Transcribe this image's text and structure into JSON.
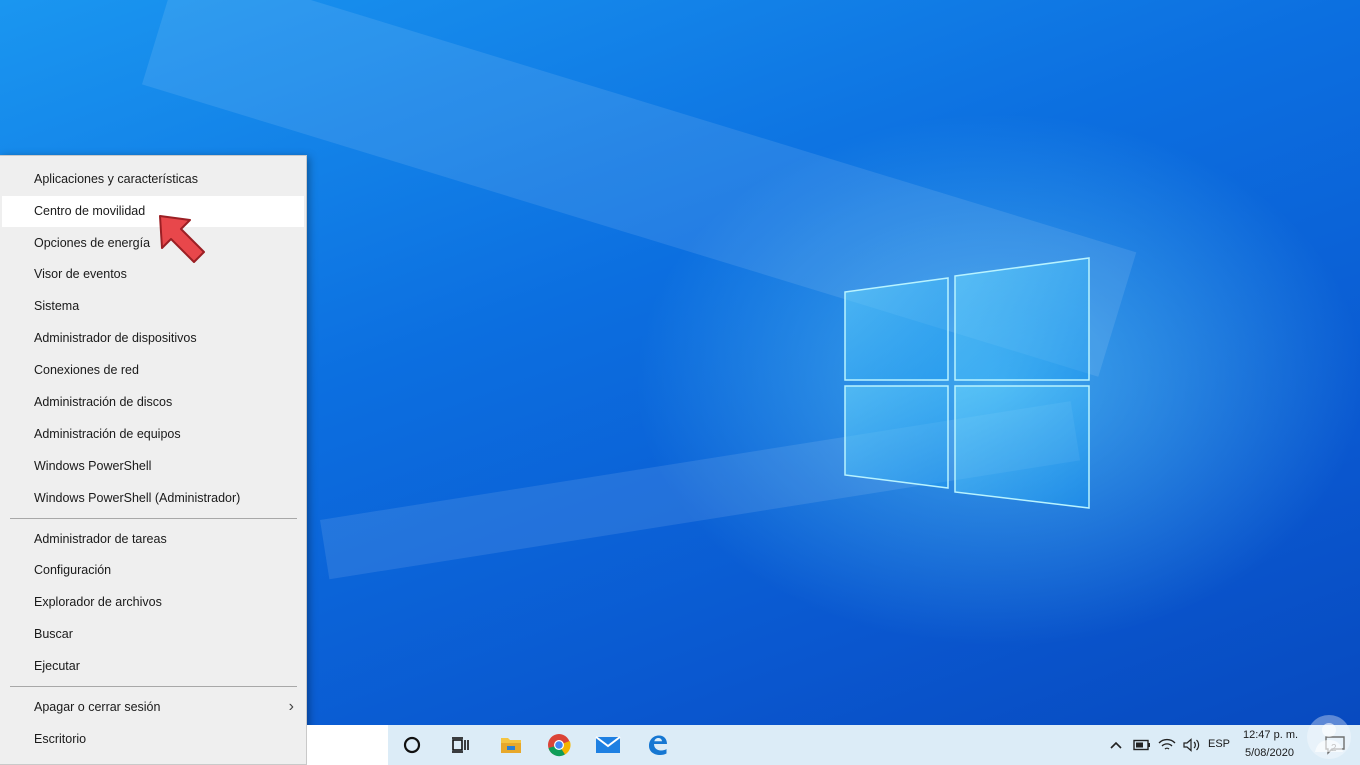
{
  "menu": {
    "group1": [
      {
        "label": "Aplicaciones y características"
      },
      {
        "label": "Centro de movilidad",
        "highlighted": true
      },
      {
        "label": "Opciones de energía"
      },
      {
        "label": "Visor de eventos"
      },
      {
        "label": "Sistema"
      },
      {
        "label": "Administrador de dispositivos"
      },
      {
        "label": "Conexiones de red"
      },
      {
        "label": "Administración de discos"
      },
      {
        "label": "Administración de equipos"
      },
      {
        "label": "Windows PowerShell"
      },
      {
        "label": "Windows PowerShell (Administrador)"
      }
    ],
    "group2": [
      {
        "label": "Administrador de tareas"
      },
      {
        "label": "Configuración"
      },
      {
        "label": "Explorador de archivos"
      },
      {
        "label": "Buscar"
      },
      {
        "label": "Ejecutar"
      }
    ],
    "group3": [
      {
        "label": "Apagar o cerrar sesión",
        "submenu_glyph": "›"
      },
      {
        "label": "Escritorio"
      }
    ]
  },
  "taskbar": {
    "icons": [
      "cortana-circle-icon",
      "task-view-icon",
      "file-explorer-icon",
      "chrome-icon",
      "mail-icon",
      "edge-icon"
    ],
    "tray": {
      "language": "ESP",
      "time": "12:47 p. m.",
      "date": "5/08/2020",
      "notification_count": "2"
    }
  },
  "colors": {
    "menu_bg": "#efefef",
    "highlight": "#ffffff",
    "pointer": "#e8474b",
    "taskbar_bg": "#dcecf7",
    "desktop_blue": "#0c6fe0"
  }
}
